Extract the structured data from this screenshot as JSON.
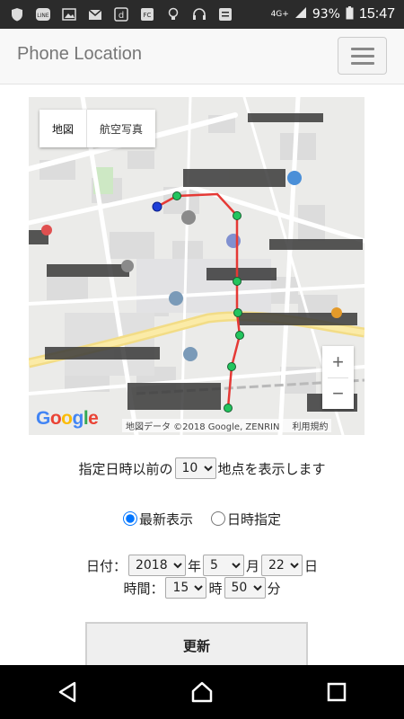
{
  "status_bar": {
    "network": "4G+",
    "battery": "93%",
    "time": "15:47",
    "left_icons": [
      "shield-icon",
      "line-icon",
      "image-icon",
      "mail-icon",
      "d-app-icon",
      "fc-app-icon",
      "bulb-icon",
      "headset-icon",
      "message-icon"
    ]
  },
  "navbar": {
    "brand": "Phone Location",
    "menu_icon": "hamburger-icon"
  },
  "map": {
    "type_buttons": [
      "地図",
      "航空写真"
    ],
    "zoom_in": "+",
    "zoom_out": "−",
    "logo": "Google",
    "attribution": [
      "地図データ ©2018 Google, ZENRIN",
      "利用規約"
    ],
    "track_color": "#e53935",
    "point_color": "#22c55e",
    "current_point_color": "#1e3fd8"
  },
  "form": {
    "count_prefix": "指定日時以前の",
    "count_value": "10",
    "count_suffix": "地点を表示します",
    "radio_latest": "最新表示",
    "radio_specify": "日時指定",
    "date_label": "日付：",
    "year": "2018",
    "year_unit": "年",
    "month": "5",
    "month_unit": "月",
    "day": "22",
    "day_unit": "日",
    "time_label": "時間：",
    "hour": "15",
    "hour_unit": "時",
    "minute": "50",
    "minute_unit": "分",
    "update_button": "更新"
  }
}
